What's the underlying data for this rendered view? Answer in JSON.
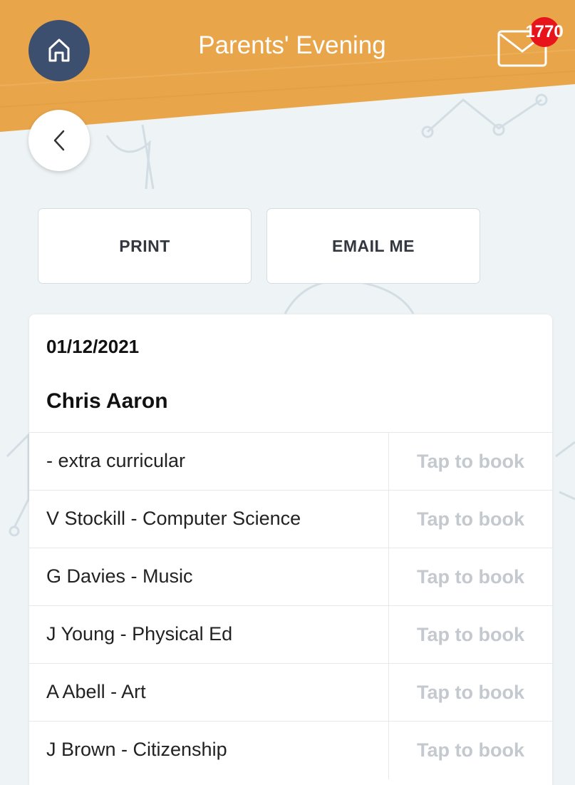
{
  "header": {
    "title": "Parents' Evening",
    "mail_count": "1770",
    "accent_color": "#e9a54a",
    "home_color": "#3c4f6f"
  },
  "actions": {
    "print_label": "PRINT",
    "email_label": "EMAIL ME"
  },
  "card": {
    "date": "01/12/2021",
    "name": "Chris Aaron",
    "rows": [
      {
        "label": "- extra curricular",
        "action": "Tap to book"
      },
      {
        "label": "V Stockill - Computer Science",
        "action": "Tap to book"
      },
      {
        "label": "G Davies - Music",
        "action": "Tap to book"
      },
      {
        "label": "J Young - Physical Ed",
        "action": "Tap to book"
      },
      {
        "label": "A Abell - Art",
        "action": "Tap to book"
      },
      {
        "label": "J Brown - Citizenship",
        "action": "Tap to book"
      }
    ]
  },
  "icons": {
    "home": "home-icon",
    "mail": "mail-icon",
    "back": "chevron-left-icon"
  }
}
